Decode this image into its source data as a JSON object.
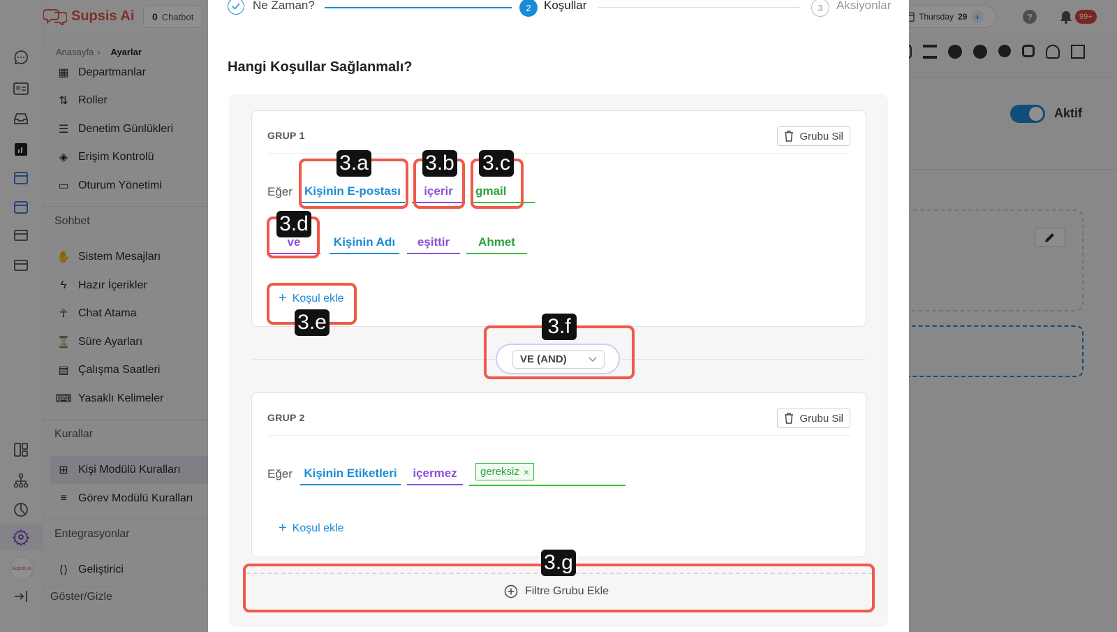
{
  "app": {
    "brand": "Supsis Ai",
    "chatbot_count": "0",
    "chatbot_label": "Chatbot",
    "date_day": "Thursday",
    "date_num": "29",
    "notif_badge": "99+",
    "avatar_text": "Supsis Ai"
  },
  "breadcrumb": {
    "home": "Anasayfa",
    "sep": "›",
    "current": "Ayarlar"
  },
  "sidebar": {
    "items_top": [
      "Departmanlar",
      "Roller",
      "Denetim Günlükleri",
      "Erişim Kontrolü",
      "Oturum Yönetimi"
    ],
    "section_chat": "Sohbet",
    "items_chat": [
      "Sistem Mesajları",
      "Hazır İçerikler",
      "Chat Atama",
      "Süre Ayarları",
      "Çalışma Saatleri",
      "Yasaklı Kelimeler"
    ],
    "section_rules": "Kurallar",
    "items_rules": [
      "Kişi Modülü Kuralları",
      "Görev Modülü Kuralları"
    ],
    "section_integrations": "Entegrasyonlar",
    "items_integrations": [
      "Geliştirici"
    ],
    "toggle_label": "Göster/Gizle"
  },
  "background": {
    "active_label": "Aktif"
  },
  "stepper": {
    "step1": "Ne Zaman?",
    "step2_num": "2",
    "step2": "Koşullar",
    "step3_num": "3",
    "step3": "Aksiyonlar"
  },
  "modal": {
    "heading": "Hangi Koşullar Sağlanmalı?",
    "delete_group": "Grubu Sil",
    "if_label": "Eğer",
    "add_condition": "Koşul ekle",
    "group_join": "VE (AND)",
    "add_filter_group": "Filtre Grubu Ekle"
  },
  "groups": [
    {
      "title": "GRUP 1",
      "rows": [
        {
          "field": "Kişinin E-postası",
          "op": "içerir",
          "value": "gmail"
        },
        {
          "joiner": "ve",
          "field": "Kişinin Adı",
          "op": "eşittir",
          "value": "Ahmet"
        }
      ]
    },
    {
      "title": "GRUP 2",
      "rows": [
        {
          "field": "Kişinin Etiketleri",
          "op": "içermez",
          "tag": "gereksiz",
          "tag_close": "×"
        }
      ]
    }
  ],
  "annotations": {
    "a": "3.a",
    "b": "3.b",
    "c": "3.c",
    "d": "3.d",
    "e": "3.e",
    "f": "3.f",
    "g": "3.g"
  },
  "colors": {
    "accent": "#1a8bd6",
    "purple": "#8a4fd8",
    "green": "#2aa33a",
    "annotation": "#f05a4a"
  }
}
